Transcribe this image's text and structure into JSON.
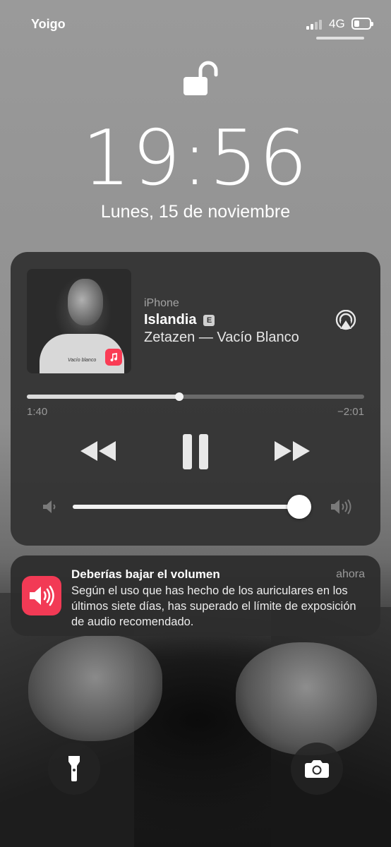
{
  "status_bar": {
    "carrier": "Yoigo",
    "network": "4G",
    "battery_level": 0.35
  },
  "lock_screen": {
    "time": "19:56",
    "date": "Lunes, 15 de noviembre",
    "lock_icon": "unlocked-padlock-icon"
  },
  "now_playing": {
    "source": "iPhone",
    "title": "Islandia",
    "explicit_badge": "E",
    "artist_album": "Zetazen — Vacío Blanco",
    "elapsed": "1:40",
    "remaining": "−2:01",
    "progress": 0.452,
    "volume": 0.95,
    "app_badge": "apple-music-icon"
  },
  "notification": {
    "title": "Deberías bajar el volumen",
    "time": "ahora",
    "body": "Según el uso que has hecho de los auriculares en los últimos siete días, has superado el límite de exposición de audio recomendado.",
    "icon": "speaker-sound-icon",
    "accent": "#f23a55"
  },
  "quick_actions": {
    "left": "flashlight-icon",
    "right": "camera-icon"
  },
  "colors": {
    "card_bg": "#323232",
    "music_red": "#fa3c55"
  }
}
